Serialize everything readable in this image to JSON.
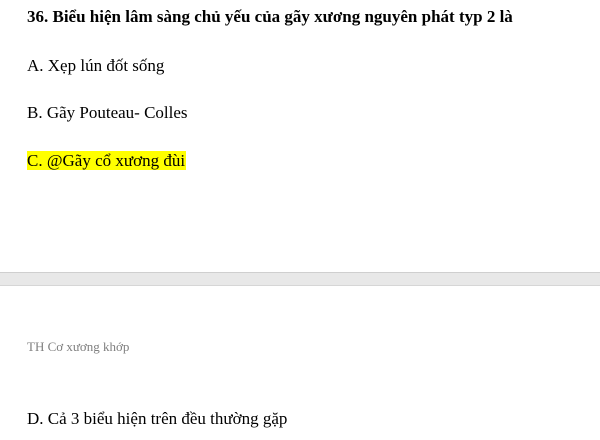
{
  "question": {
    "text": "36. Biểu hiện lâm sàng chủ yếu của gãy xương nguyên phát typ 2 là"
  },
  "options": [
    {
      "label": "A. Xẹp lún đốt sống"
    },
    {
      "label": "B. Gãy Pouteau- Colles"
    },
    {
      "label": "C. @Gãy cổ xương đùi",
      "highlight_color": "#ffff00"
    },
    {
      "label": "D. Cả 3 biểu hiện trên đều thường gặp"
    }
  ],
  "page_header": {
    "text": "TH Cơ xương khớp"
  }
}
